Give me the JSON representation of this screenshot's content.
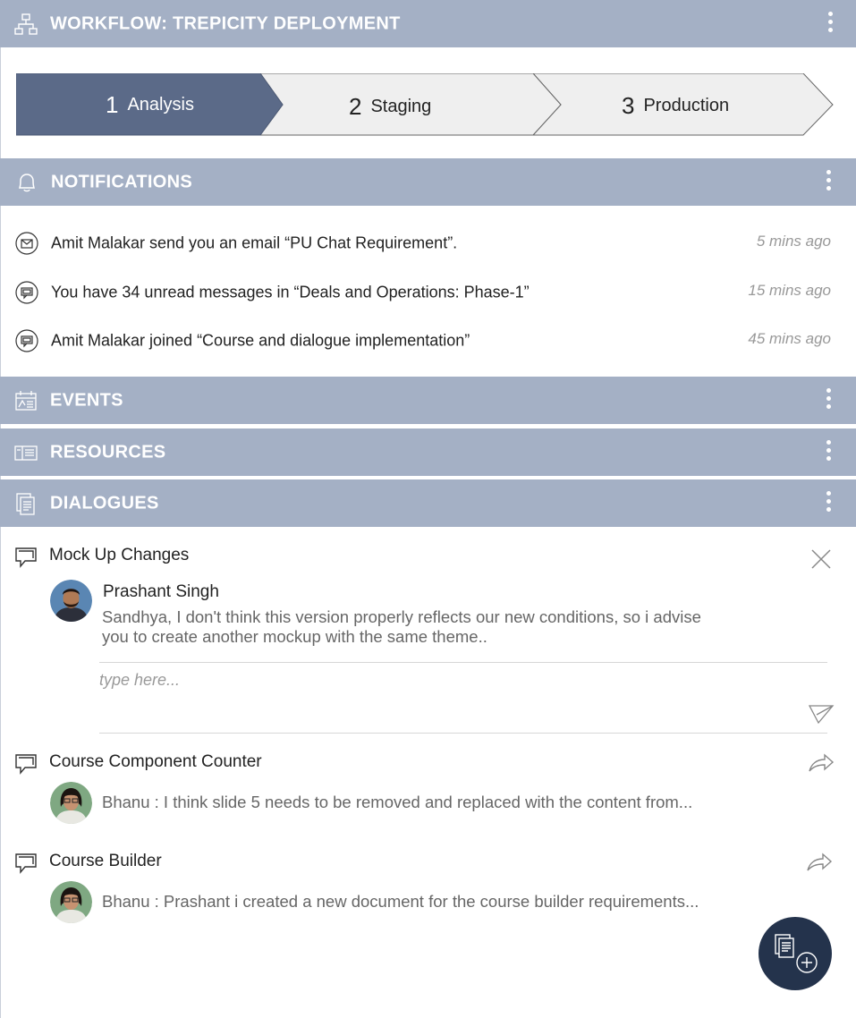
{
  "workflow": {
    "title": "WORKFLOW: TREPICITY DEPLOYMENT",
    "steps": [
      {
        "number": "1",
        "label": "Analysis",
        "active": true
      },
      {
        "number": "2",
        "label": "Staging",
        "active": false
      },
      {
        "number": "3",
        "label": "Production",
        "active": false
      }
    ]
  },
  "notifications": {
    "title": "NOTIFICATIONS",
    "items": [
      {
        "icon": "email-icon",
        "text": "Amit Malakar send you an email “PU Chat Requirement”.",
        "time": "5 mins ago"
      },
      {
        "icon": "chat-icon",
        "text": "You have 34 unread messages in “Deals and Operations: Phase-1”",
        "time": "15 mins ago"
      },
      {
        "icon": "chat-icon",
        "text": "Amit Malakar joined “Course and dialogue implementation”",
        "time": "45 mins ago"
      }
    ]
  },
  "events": {
    "title": "EVENTS"
  },
  "resources": {
    "title": "RESOURCES"
  },
  "dialogues": {
    "title": "DIALOGUES",
    "items": [
      {
        "title": "Mock Up Changes",
        "author": "Prashant Singh",
        "message_line1": "Sandhya, I don't think this version properly reflects our new conditions, so i advise",
        "message_line2": "you to create another mockup with the same theme..",
        "reply_placeholder": "type here..."
      },
      {
        "title": "Course Component Counter",
        "message": "Bhanu : I think slide 5 needs to be removed and replaced with the content from..."
      },
      {
        "title": "Course Builder",
        "message": "Bhanu : Prashant i created a new document for the course builder requirements..."
      }
    ]
  },
  "colors": {
    "header_bg": "#a4b0c5",
    "step_active": "#5b6a88",
    "step_inactive": "#efefef",
    "fab_bg": "#24334c"
  }
}
